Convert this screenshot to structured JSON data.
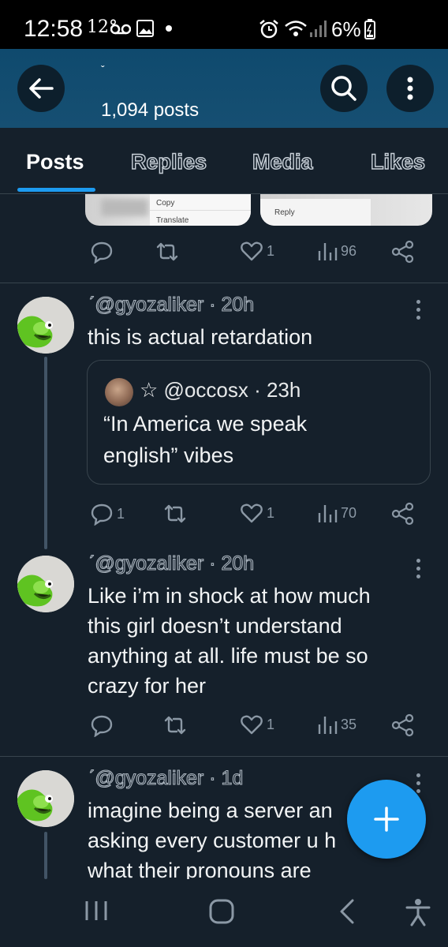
{
  "status_bar": {
    "time": "12:58",
    "temperature": "12°",
    "battery_percent": "6%",
    "icons": [
      "voicemail-icon",
      "image-icon",
      "dot-icon",
      "alarm-icon",
      "wifi-icon",
      "signal-icon",
      "battery-icon"
    ]
  },
  "header": {
    "name": "ˇ",
    "post_count": "1,094 posts",
    "icons": [
      "back-arrow-icon",
      "search-icon",
      "more-vertical-icon"
    ]
  },
  "tabs": [
    {
      "label": "Posts",
      "active": true
    },
    {
      "label": "Replies",
      "active": false
    },
    {
      "label": "Media",
      "active": false
    },
    {
      "label": "Likes",
      "active": false
    }
  ],
  "previous_media": {
    "menu_left": [
      "Copy",
      "Translate"
    ],
    "menu_right": [
      "Reply"
    ]
  },
  "previous_actions": {
    "replies": "",
    "reposts": "",
    "likes": "1",
    "views": "96"
  },
  "posts": [
    {
      "handle": "ˊ@gyozaliker · 20h",
      "text": "this is actual retardation",
      "quote": {
        "handle": "☆ @occosx · 23h",
        "text_line1": "“In America we speak",
        "text_line2": "english” vibes"
      },
      "actions": {
        "replies": "1",
        "reposts": "",
        "likes": "1",
        "views": "70"
      }
    },
    {
      "handle": "ˊ@gyozaliker · 20h",
      "lines": [
        "Like i’m in shock at how much",
        "this girl doesn’t understand",
        "anything at all. life must be so",
        "crazy for her"
      ],
      "actions": {
        "replies": "",
        "reposts": "",
        "likes": "1",
        "views": "35"
      }
    },
    {
      "handle": "ˊ@gyozaliker · 1d",
      "lines": [
        "imagine being a server an",
        "asking every customer u h",
        "what their pronouns are"
      ]
    }
  ],
  "fab": {
    "icon": "plus-icon"
  },
  "nav_bar": {
    "icons": [
      "recent-apps-icon",
      "home-icon",
      "back-icon",
      "accessibility-icon"
    ]
  },
  "colors": {
    "background": "#15202b",
    "accent": "#1d9bf0",
    "muted": "#8b98a5",
    "header": "#164f72"
  }
}
